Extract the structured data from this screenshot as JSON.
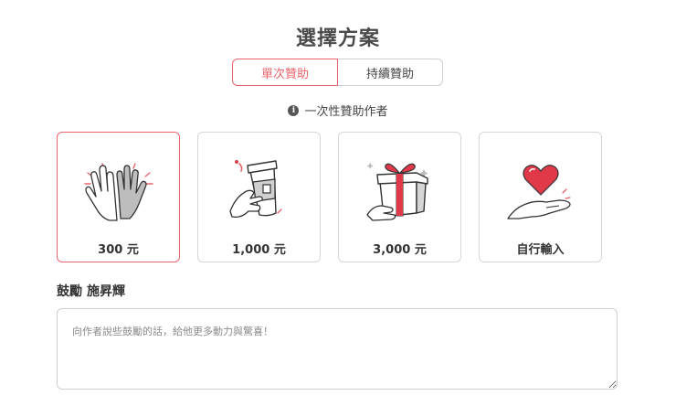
{
  "page": {
    "title": "選擇方案"
  },
  "tabs": [
    {
      "label": "單次贊助",
      "active": true
    },
    {
      "label": "持續贊助",
      "active": false
    }
  ],
  "note": {
    "icon": "info-icon",
    "text": "一次性贊助作者"
  },
  "plans": [
    {
      "label": "300 元",
      "icon": "high-five-icon",
      "selected": true
    },
    {
      "label": "1,000 元",
      "icon": "coffee-cup-icon",
      "selected": false
    },
    {
      "label": "3,000 元",
      "icon": "gift-box-icon",
      "selected": false
    },
    {
      "label": "自行輸入",
      "icon": "heart-hand-icon",
      "selected": false
    }
  ],
  "encourage": {
    "prefix": "鼓勵",
    "author": "施昇輝"
  },
  "message": {
    "placeholder": "向作者說些鼓勵的話，給他更多動力與驚喜！",
    "value": ""
  },
  "colors": {
    "accent": "#e8646c",
    "border": "#d6d6d6",
    "text": "#333333",
    "hand_gray": "#bdbdbd",
    "gift_red": "#e03a4a"
  }
}
